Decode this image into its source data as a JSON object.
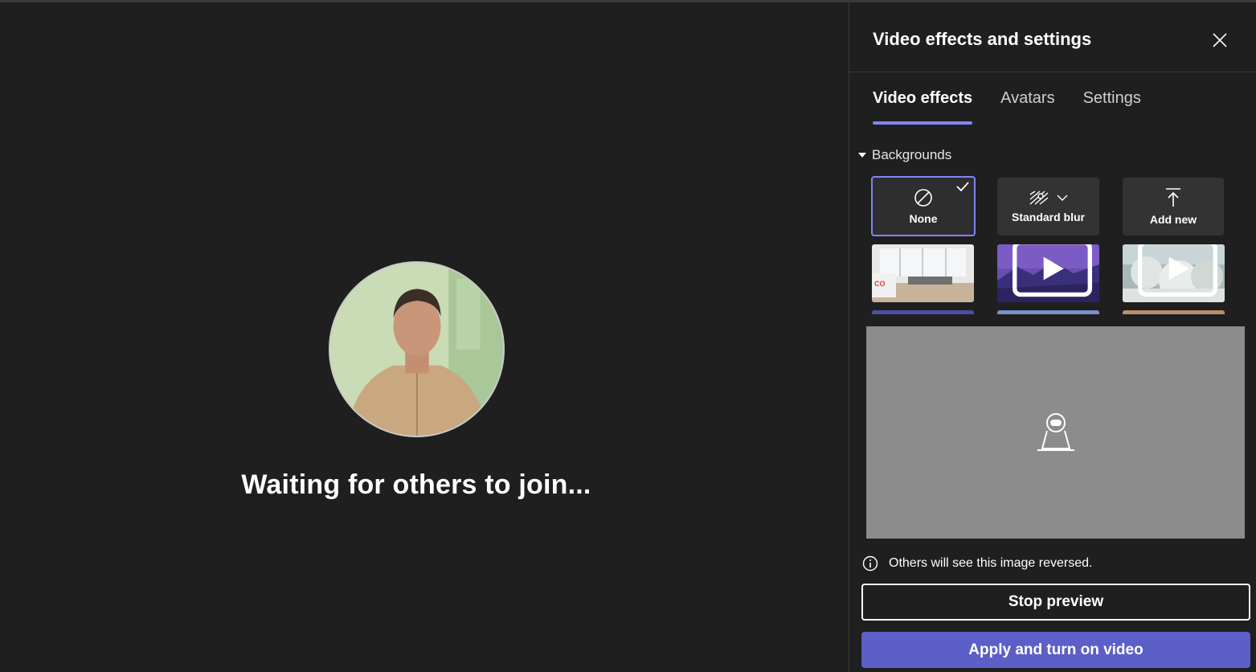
{
  "stage": {
    "status_text": "Waiting for others to join..."
  },
  "panel": {
    "title": "Video effects and settings",
    "close_icon": "close-icon",
    "tabs": [
      {
        "label": "Video effects",
        "active": true
      },
      {
        "label": "Avatars",
        "active": false
      },
      {
        "label": "Settings",
        "active": false
      }
    ],
    "section_label": "Backgrounds",
    "backgrounds": [
      {
        "label": "None",
        "icon": "none-icon",
        "selected": true
      },
      {
        "label": "Standard blur",
        "icon": "blur-icon",
        "selected": false
      },
      {
        "label": "Add new",
        "icon": "upload-icon",
        "selected": false
      }
    ],
    "image_backgrounds": [
      {
        "name": "office-room",
        "video": false
      },
      {
        "name": "purple-mountains",
        "video": true
      },
      {
        "name": "snowy-trees",
        "video": true
      }
    ],
    "preview_icon": "camera-off-icon",
    "info_text": "Others will see this image reversed.",
    "stop_preview_label": "Stop preview",
    "apply_label": "Apply and turn on video"
  },
  "colors": {
    "accent": "#7f85f5",
    "primary_button": "#5b5fc7",
    "background": "#1f1f1f",
    "preview_bg": "#8c8c8c"
  }
}
